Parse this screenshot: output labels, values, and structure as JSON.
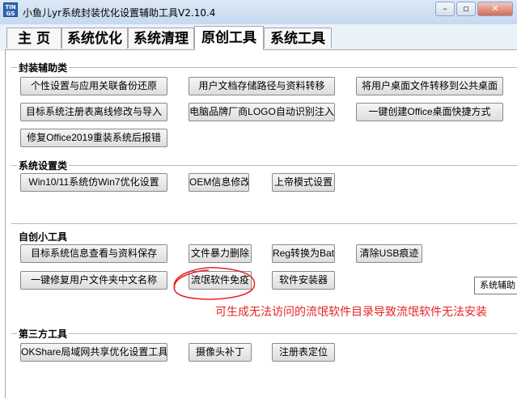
{
  "window": {
    "title": "小鱼儿yr系统封装优化设置辅助工具V2.10.4",
    "icon_text": "TIN GS",
    "controls": [
      "minimize-icon",
      "maximize-icon",
      "close-icon"
    ]
  },
  "tabs": [
    {
      "label": "主 页"
    },
    {
      "label": "系统优化"
    },
    {
      "label": "系统清理"
    },
    {
      "label": "原创工具",
      "active": true
    },
    {
      "label": "系统工具"
    }
  ],
  "sections": {
    "packaging": {
      "title": "封装辅助类",
      "buttons": [
        "个性设置与应用关联备份还原",
        "用户文档存储路径与资料转移",
        "将用户桌面文件转移到公共桌面",
        "目标系统注册表离线修改与导入",
        "电脑品牌厂商LOGO自动识别注入",
        "一键创建Office桌面快捷方式",
        "修复Office2019重装系统后报错"
      ]
    },
    "settings": {
      "title": "系统设置类",
      "buttons": [
        "Win10/11系统仿Win7优化设置",
        "OEM信息修改",
        "上帝模式设置"
      ]
    },
    "tools": {
      "title": "自创小工具",
      "buttons": [
        "目标系统信息查看与资料保存",
        "文件暴力删除",
        "Reg转换为Bat",
        "清除USB痕迹",
        "一键修复用户文件夹中文名称",
        "流氓软件免疫",
        "软件安装器"
      ]
    },
    "thirdparty": {
      "title": "第三方工具",
      "buttons": [
        "OKShare局域网共享优化设置工具",
        "摄像头补丁",
        "注册表定位"
      ]
    }
  },
  "annotation": "可生成无法访问的流氓软件目录导致流氓软件无法安装",
  "tooltip": "系统辅助",
  "colors": {
    "annotation": "#e52323",
    "titlebar": "#c6d9ef"
  }
}
